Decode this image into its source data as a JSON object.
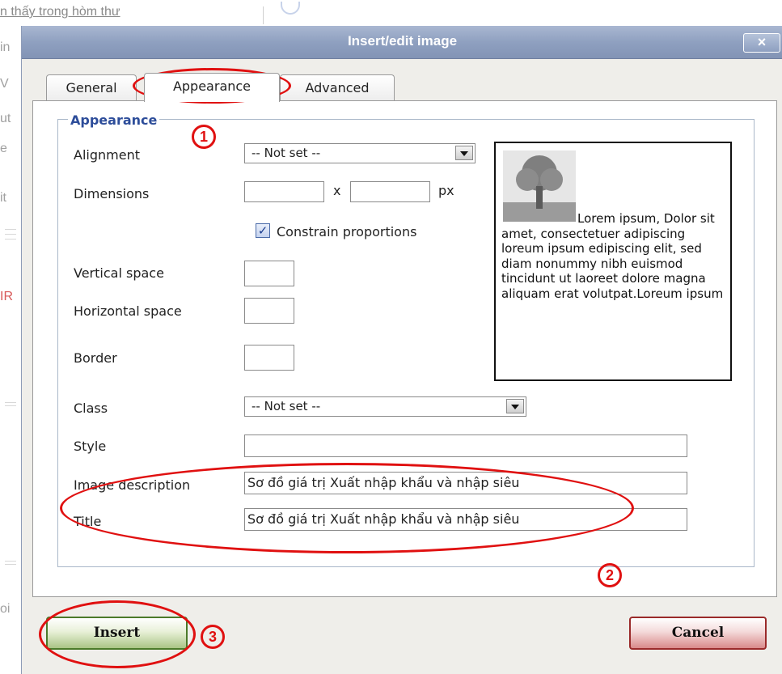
{
  "background": {
    "top_text": "n thấy trong hòm thư",
    "left_fragments": [
      "in",
      "V",
      "ut",
      "e",
      "it",
      "IR",
      "oi"
    ]
  },
  "dialog": {
    "title": "Insert/edit image",
    "close_label": "×",
    "tabs": [
      {
        "label": "General"
      },
      {
        "label": "Appearance"
      },
      {
        "label": "Advanced"
      }
    ],
    "active_tab": "Appearance",
    "legend": "Appearance",
    "fields": {
      "alignment": {
        "label": "Alignment",
        "value": "-- Not set --"
      },
      "dimensions": {
        "label": "Dimensions",
        "width": "",
        "height": "",
        "separator": "x",
        "unit": "px"
      },
      "constrain": {
        "label": "Constrain proportions",
        "checked": true,
        "mark": "✓"
      },
      "vspace": {
        "label": "Vertical space",
        "value": ""
      },
      "hspace": {
        "label": "Horizontal space",
        "value": ""
      },
      "border": {
        "label": "Border",
        "value": ""
      },
      "class": {
        "label": "Class",
        "value": "-- Not set --"
      },
      "style": {
        "label": "Style",
        "value": ""
      },
      "image_description": {
        "label": "Image description",
        "value": "Sơ đồ giá trị Xuất nhập khẩu và nhập siêu"
      },
      "title": {
        "label": "Title",
        "value": "Sơ đồ giá trị Xuất nhập khẩu và nhập siêu"
      }
    },
    "preview_text": "Lorem ipsum, Dolor sit amet, consectetuer adipiscing loreum ipsum edipiscing elit, sed diam nonummy nibh euismod tincidunt ut laoreet dolore magna aliquam erat volutpat.Loreum ipsum",
    "buttons": {
      "insert": "Insert",
      "cancel": "Cancel"
    }
  },
  "annotations": {
    "marker_1": "1",
    "marker_2": "2",
    "marker_3": "3",
    "color": "#e01010"
  }
}
